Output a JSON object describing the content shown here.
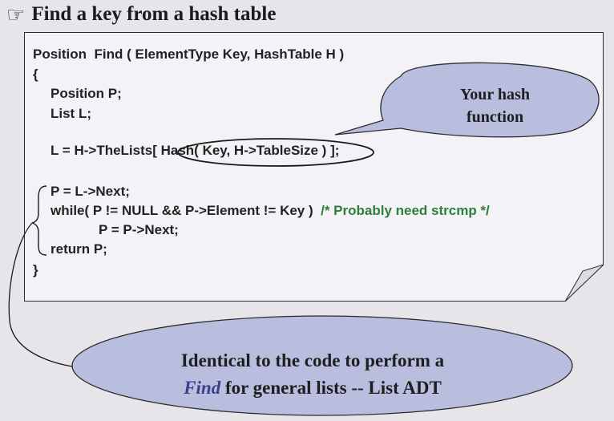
{
  "slide": {
    "title_icon": "pointing-hand-icon",
    "title": "Find a key from a hash table"
  },
  "code": {
    "line1": "Position  Find ( ElementType Key, HashTable H )",
    "line2": "{",
    "line3": "Position P;",
    "line4": "List L;",
    "line5_start": "L = H->TheLists[ ",
    "line5_hash": "Hash( Key, H->TableSize )",
    "line5_end": " ];",
    "line6": "P = L->Next;",
    "line7_code": "while( P != NULL && P->Element != Key )  ",
    "line7_comment": "/* Probably need strcmp */",
    "line8": "P = P->Next;",
    "line9": "return P;",
    "line10": "}"
  },
  "callout_hash": {
    "line1": "Your hash",
    "line2": "function"
  },
  "callout_find": {
    "line1": "Identical to the code to perform a",
    "line2_em": "Find",
    "line2_rest": " for general lists  -- List ADT"
  },
  "colors": {
    "ellipse_fill": "#b9bedf",
    "comment": "#2e7d3a",
    "box_fill": "#f3f3f7"
  }
}
